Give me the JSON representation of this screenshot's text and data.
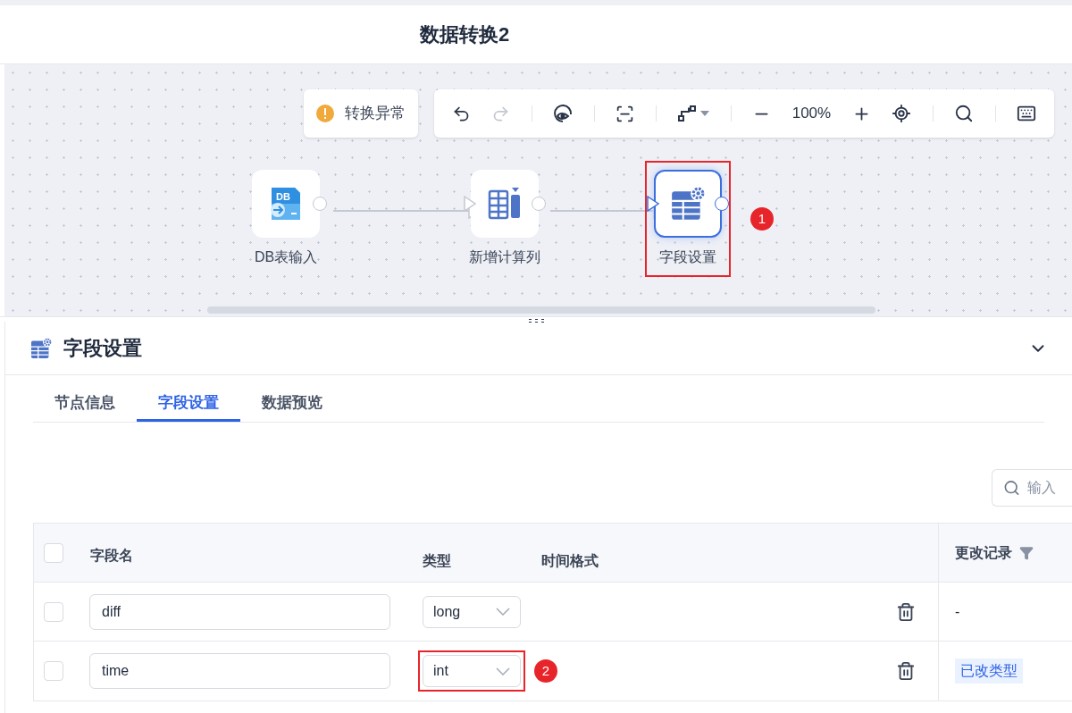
{
  "header": {
    "title": "数据转换2"
  },
  "canvas": {
    "status": {
      "text": "转换异常"
    },
    "toolbar": {
      "zoom": "100%",
      "redo_disabled": true
    },
    "nodes": [
      {
        "label": "DB表输入",
        "kind": "db-input",
        "icon_text": "DB",
        "selected": false,
        "has_input": false
      },
      {
        "label": "新增计算列",
        "kind": "add-column",
        "selected": false,
        "has_input": true
      },
      {
        "label": "字段设置",
        "kind": "field-settings",
        "selected": true,
        "has_input": true,
        "badge": "1"
      }
    ]
  },
  "panel": {
    "title": "字段设置",
    "tabs": [
      {
        "label": "节点信息",
        "selected": false
      },
      {
        "label": "字段设置",
        "selected": true
      },
      {
        "label": "数据预览",
        "selected": false
      }
    ],
    "search": {
      "placeholder": "输入"
    },
    "table": {
      "all_checked": false,
      "columns": [
        "字段名",
        "类型",
        "时间格式",
        "更改记录"
      ],
      "rows": [
        {
          "checked": false,
          "name": "diff",
          "type": "long",
          "change": "-",
          "change_is_tag": false
        },
        {
          "checked": false,
          "name": "time",
          "type": "int",
          "change": "已改类型",
          "change_is_tag": true,
          "badge": "2"
        }
      ]
    }
  }
}
